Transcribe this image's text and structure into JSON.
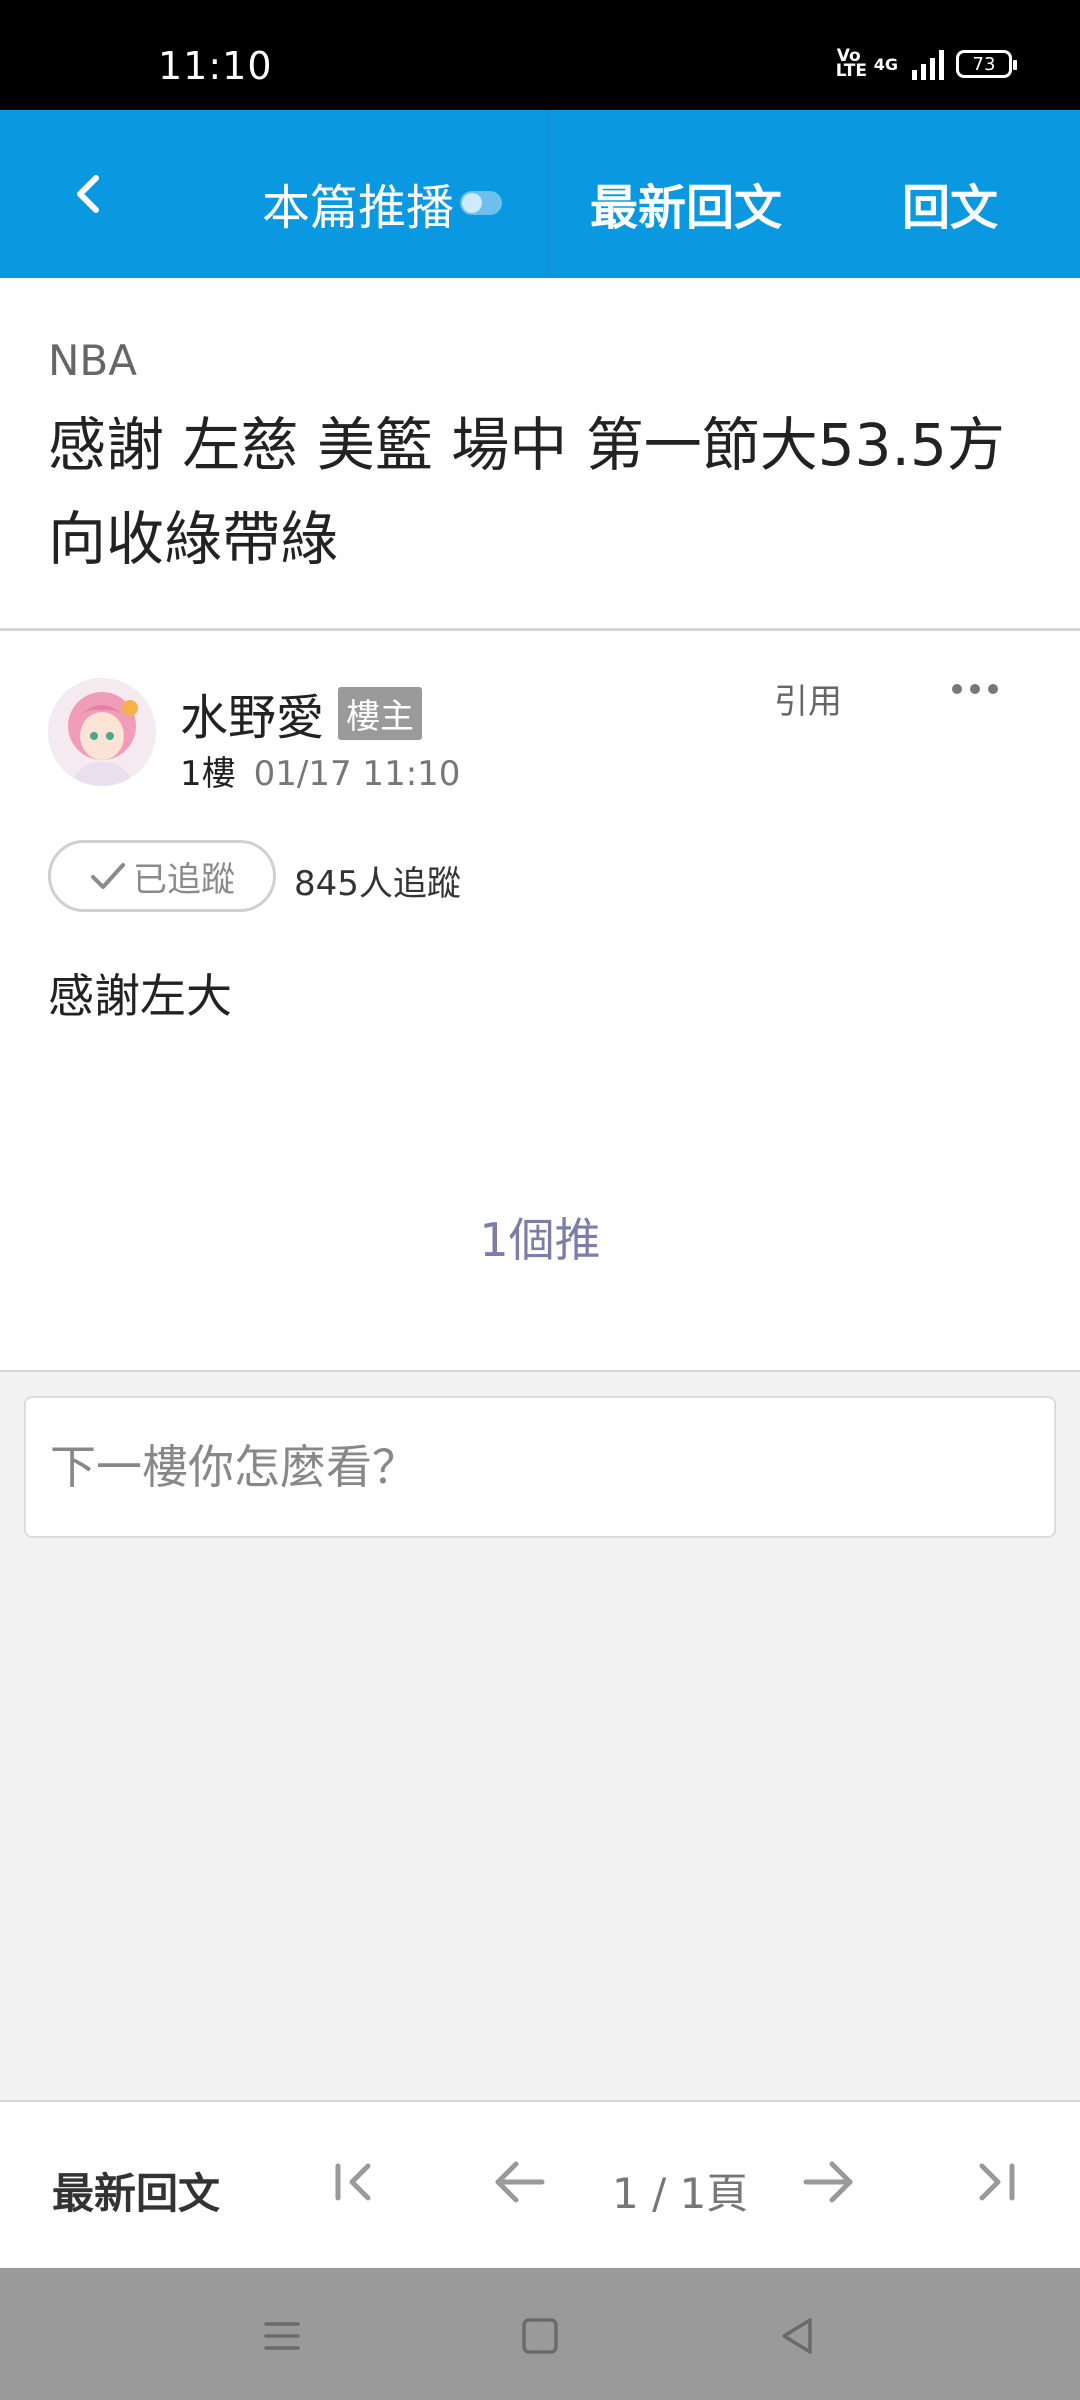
{
  "status_bar": {
    "time": "11:10",
    "volte": "Vo\nLTE",
    "network": "4G",
    "battery": "73"
  },
  "top_nav": {
    "back_icon": "chevron-left-icon",
    "push_label": "本篇推播",
    "latest_label": "最新回文",
    "reply_label": "回文"
  },
  "post": {
    "board": "NBA",
    "title": "感謝 左慈 美籃 場中 第一節大53.5方向收綠帶綠",
    "author": {
      "name": "水野愛",
      "badge": "樓主",
      "floor": "1樓",
      "time": "01/17 11:10"
    },
    "quote_label": "引用",
    "follow": {
      "button_label": "已追蹤",
      "count_text": "845人追蹤"
    },
    "body": "感謝左大",
    "push_count": "1個推"
  },
  "reply": {
    "placeholder": "下一樓你怎麼看？"
  },
  "bottom_bar": {
    "latest_label": "最新回文",
    "page_indicator": "1 / 1頁",
    "icons": [
      "first-page-icon",
      "prev-page-icon",
      "next-page-icon",
      "last-page-icon"
    ]
  },
  "colors": {
    "accent": "#0a98e0",
    "push_count": "#7c7ea8"
  }
}
